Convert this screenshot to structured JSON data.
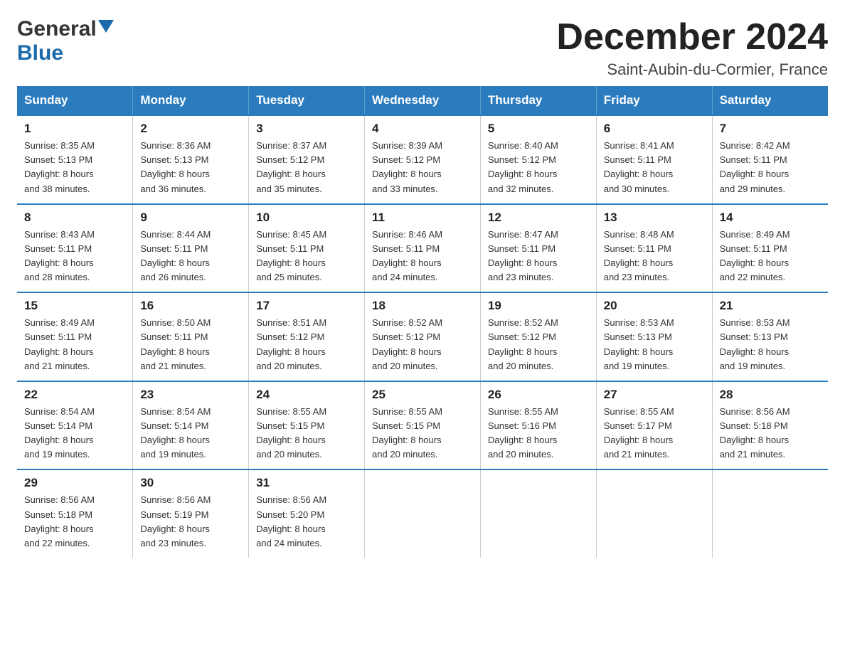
{
  "logo": {
    "general": "General",
    "blue": "Blue",
    "arrow": "▲"
  },
  "title": "December 2024",
  "subtitle": "Saint-Aubin-du-Cormier, France",
  "headers": [
    "Sunday",
    "Monday",
    "Tuesday",
    "Wednesday",
    "Thursday",
    "Friday",
    "Saturday"
  ],
  "weeks": [
    [
      {
        "day": "1",
        "sunrise": "8:35 AM",
        "sunset": "5:13 PM",
        "daylight": "8 hours and 38 minutes."
      },
      {
        "day": "2",
        "sunrise": "8:36 AM",
        "sunset": "5:13 PM",
        "daylight": "8 hours and 36 minutes."
      },
      {
        "day": "3",
        "sunrise": "8:37 AM",
        "sunset": "5:12 PM",
        "daylight": "8 hours and 35 minutes."
      },
      {
        "day": "4",
        "sunrise": "8:39 AM",
        "sunset": "5:12 PM",
        "daylight": "8 hours and 33 minutes."
      },
      {
        "day": "5",
        "sunrise": "8:40 AM",
        "sunset": "5:12 PM",
        "daylight": "8 hours and 32 minutes."
      },
      {
        "day": "6",
        "sunrise": "8:41 AM",
        "sunset": "5:11 PM",
        "daylight": "8 hours and 30 minutes."
      },
      {
        "day": "7",
        "sunrise": "8:42 AM",
        "sunset": "5:11 PM",
        "daylight": "8 hours and 29 minutes."
      }
    ],
    [
      {
        "day": "8",
        "sunrise": "8:43 AM",
        "sunset": "5:11 PM",
        "daylight": "8 hours and 28 minutes."
      },
      {
        "day": "9",
        "sunrise": "8:44 AM",
        "sunset": "5:11 PM",
        "daylight": "8 hours and 26 minutes."
      },
      {
        "day": "10",
        "sunrise": "8:45 AM",
        "sunset": "5:11 PM",
        "daylight": "8 hours and 25 minutes."
      },
      {
        "day": "11",
        "sunrise": "8:46 AM",
        "sunset": "5:11 PM",
        "daylight": "8 hours and 24 minutes."
      },
      {
        "day": "12",
        "sunrise": "8:47 AM",
        "sunset": "5:11 PM",
        "daylight": "8 hours and 23 minutes."
      },
      {
        "day": "13",
        "sunrise": "8:48 AM",
        "sunset": "5:11 PM",
        "daylight": "8 hours and 23 minutes."
      },
      {
        "day": "14",
        "sunrise": "8:49 AM",
        "sunset": "5:11 PM",
        "daylight": "8 hours and 22 minutes."
      }
    ],
    [
      {
        "day": "15",
        "sunrise": "8:49 AM",
        "sunset": "5:11 PM",
        "daylight": "8 hours and 21 minutes."
      },
      {
        "day": "16",
        "sunrise": "8:50 AM",
        "sunset": "5:11 PM",
        "daylight": "8 hours and 21 minutes."
      },
      {
        "day": "17",
        "sunrise": "8:51 AM",
        "sunset": "5:12 PM",
        "daylight": "8 hours and 20 minutes."
      },
      {
        "day": "18",
        "sunrise": "8:52 AM",
        "sunset": "5:12 PM",
        "daylight": "8 hours and 20 minutes."
      },
      {
        "day": "19",
        "sunrise": "8:52 AM",
        "sunset": "5:12 PM",
        "daylight": "8 hours and 20 minutes."
      },
      {
        "day": "20",
        "sunrise": "8:53 AM",
        "sunset": "5:13 PM",
        "daylight": "8 hours and 19 minutes."
      },
      {
        "day": "21",
        "sunrise": "8:53 AM",
        "sunset": "5:13 PM",
        "daylight": "8 hours and 19 minutes."
      }
    ],
    [
      {
        "day": "22",
        "sunrise": "8:54 AM",
        "sunset": "5:14 PM",
        "daylight": "8 hours and 19 minutes."
      },
      {
        "day": "23",
        "sunrise": "8:54 AM",
        "sunset": "5:14 PM",
        "daylight": "8 hours and 19 minutes."
      },
      {
        "day": "24",
        "sunrise": "8:55 AM",
        "sunset": "5:15 PM",
        "daylight": "8 hours and 20 minutes."
      },
      {
        "day": "25",
        "sunrise": "8:55 AM",
        "sunset": "5:15 PM",
        "daylight": "8 hours and 20 minutes."
      },
      {
        "day": "26",
        "sunrise": "8:55 AM",
        "sunset": "5:16 PM",
        "daylight": "8 hours and 20 minutes."
      },
      {
        "day": "27",
        "sunrise": "8:55 AM",
        "sunset": "5:17 PM",
        "daylight": "8 hours and 21 minutes."
      },
      {
        "day": "28",
        "sunrise": "8:56 AM",
        "sunset": "5:18 PM",
        "daylight": "8 hours and 21 minutes."
      }
    ],
    [
      {
        "day": "29",
        "sunrise": "8:56 AM",
        "sunset": "5:18 PM",
        "daylight": "8 hours and 22 minutes."
      },
      {
        "day": "30",
        "sunrise": "8:56 AM",
        "sunset": "5:19 PM",
        "daylight": "8 hours and 23 minutes."
      },
      {
        "day": "31",
        "sunrise": "8:56 AM",
        "sunset": "5:20 PM",
        "daylight": "8 hours and 24 minutes."
      },
      null,
      null,
      null,
      null
    ]
  ],
  "labels": {
    "sunrise": "Sunrise:",
    "sunset": "Sunset:",
    "daylight": "Daylight:"
  }
}
